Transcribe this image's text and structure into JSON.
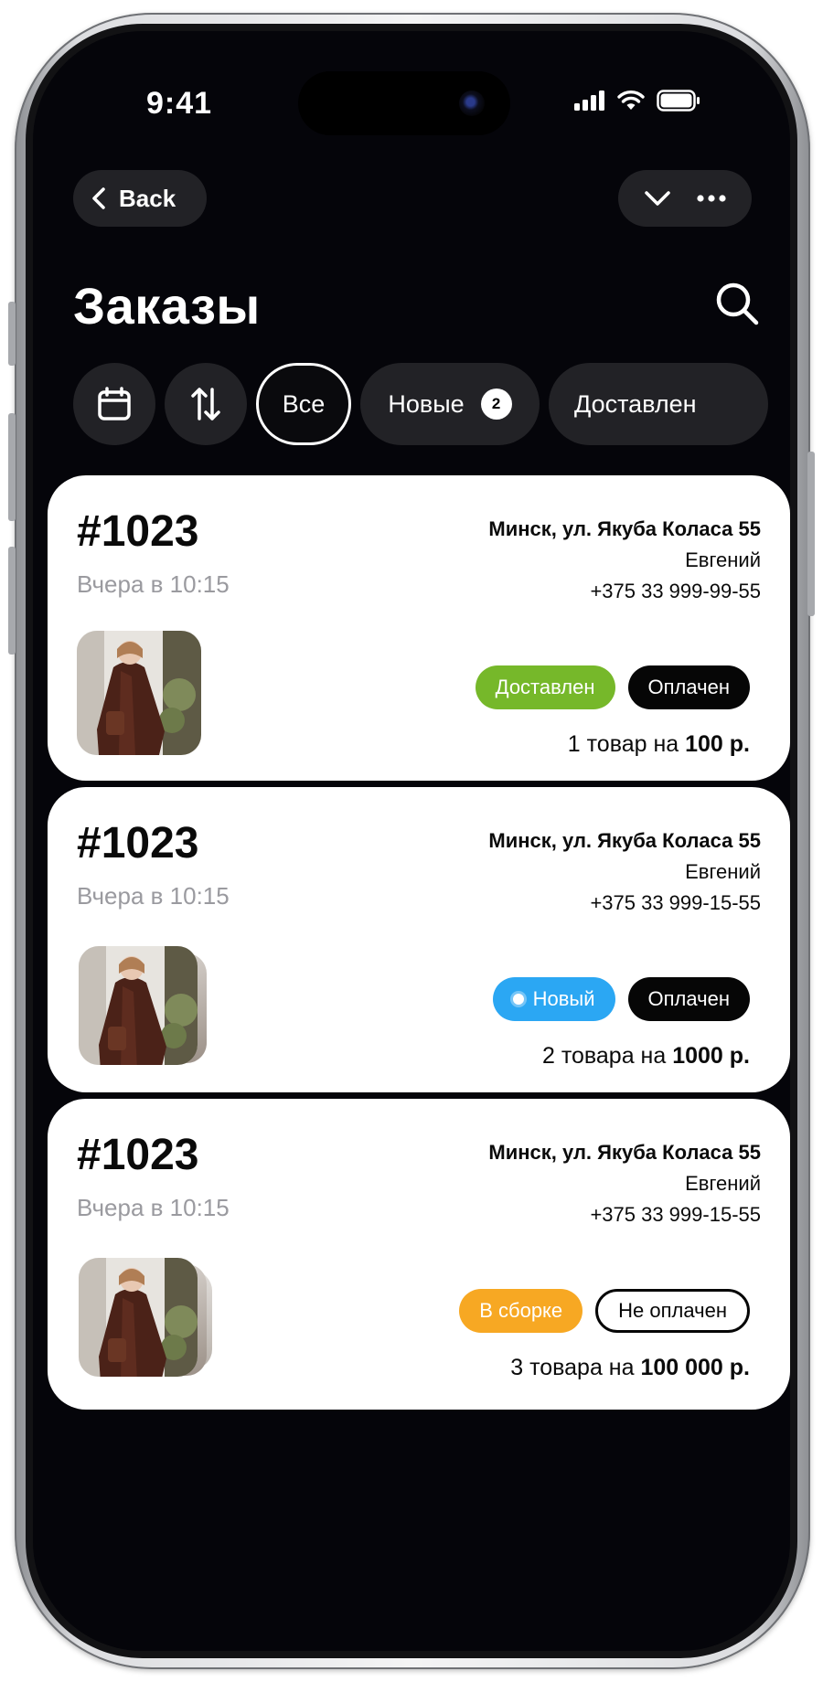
{
  "status_bar": {
    "time": "9:41"
  },
  "nav": {
    "back_label": "Back"
  },
  "page": {
    "title": "Заказы"
  },
  "filters": {
    "all_label": "Все",
    "new_label": "Новые",
    "new_count": "2",
    "delivered_label": "Доставлен"
  },
  "orders": [
    {
      "number": "#1023",
      "time": "Вчера в 10:15",
      "address": "Минск, ул. Якуба Коласа 55",
      "customer": "Евгений",
      "phone": "+375 33 999-99-55",
      "status": "Доставлен",
      "payment": "Оплачен",
      "items_text": "1 товар на",
      "total": "100 р."
    },
    {
      "number": "#1023",
      "time": "Вчера в 10:15",
      "address": "Минск, ул. Якуба Коласа 55",
      "customer": "Евгений",
      "phone": "+375 33 999-15-55",
      "status": "Новый",
      "payment": "Оплачен",
      "items_text": "2 товара на",
      "total": "1000 р."
    },
    {
      "number": "#1023",
      "time": "Вчера в 10:15",
      "address": "Минск, ул. Якуба Коласа 55",
      "customer": "Евгений",
      "phone": "+375 33 999-15-55",
      "status": "В сборке",
      "payment": "Не оплачен",
      "items_text": "3 товара на",
      "total": "100 000 р."
    }
  ],
  "colors": {
    "delivered": "#76b82a",
    "new": "#2ba7f3",
    "assembly": "#f7a823",
    "screen_bg": "#05050a"
  }
}
